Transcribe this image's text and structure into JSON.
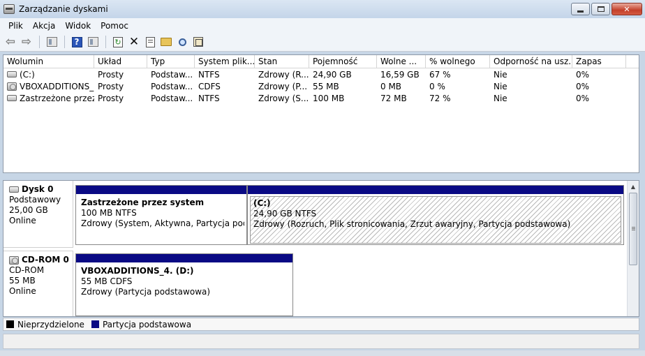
{
  "window": {
    "title": "Zarządzanie dyskami"
  },
  "menu": [
    "Plik",
    "Akcja",
    "Widok",
    "Pomoc"
  ],
  "columns": [
    "Wolumin",
    "Układ",
    "Typ",
    "System plik...",
    "Stan",
    "Pojemność",
    "Wolne ...",
    "% wolnego",
    "Odporność na usz...",
    "Zapas"
  ],
  "volumes": [
    {
      "icon": "drive-icon",
      "cells": [
        "(C:)",
        "Prosty",
        "Podstaw...",
        "NTFS",
        "Zdrowy (R...",
        "24,90 GB",
        "16,59 GB",
        "67 %",
        "Nie",
        "0%"
      ]
    },
    {
      "icon": "cd-drive-icon",
      "cells": [
        "VBOXADDITIONS_...",
        "Prosty",
        "Podstaw...",
        "CDFS",
        "Zdrowy (P...",
        "55 MB",
        "0 MB",
        "0 %",
        "Nie",
        "0%"
      ]
    },
    {
      "icon": "drive-icon",
      "cells": [
        "Zastrzeżone przez ...",
        "Prosty",
        "Podstaw...",
        "NTFS",
        "Zdrowy (S...",
        "100 MB",
        "72 MB",
        "72 %",
        "Nie",
        "0%"
      ]
    }
  ],
  "disk0": {
    "name": "Dysk 0",
    "type": "Podstawowy",
    "size": "25,00 GB",
    "status": "Online",
    "partitions": [
      {
        "name": "Zastrzeżone przez system",
        "size": "100 MB NTFS",
        "status": "Zdrowy (System, Aktywna, Partycja podstaw"
      },
      {
        "name": "(C:)",
        "size": "24,90 GB NTFS",
        "status": "Zdrowy (Rozruch, Plik stronicowania, Zrzut awaryjny, Partycja podstawowa)"
      }
    ]
  },
  "cdrom0": {
    "name": "CD-ROM 0",
    "type": "CD-ROM",
    "size": "55 MB",
    "status": "Online",
    "partitions": [
      {
        "name": "VBOXADDITIONS_4.  (D:)",
        "size": "55 MB CDFS",
        "status": "Zdrowy (Partycja podstawowa)"
      }
    ]
  },
  "legend": [
    {
      "label": "Nieprzydzielone",
      "color": "#000000"
    },
    {
      "label": "Partycja podstawowa",
      "color": "#0a0a84"
    }
  ],
  "colors": {
    "partition_bar": "#0a0a84",
    "unallocated": "#000000"
  }
}
